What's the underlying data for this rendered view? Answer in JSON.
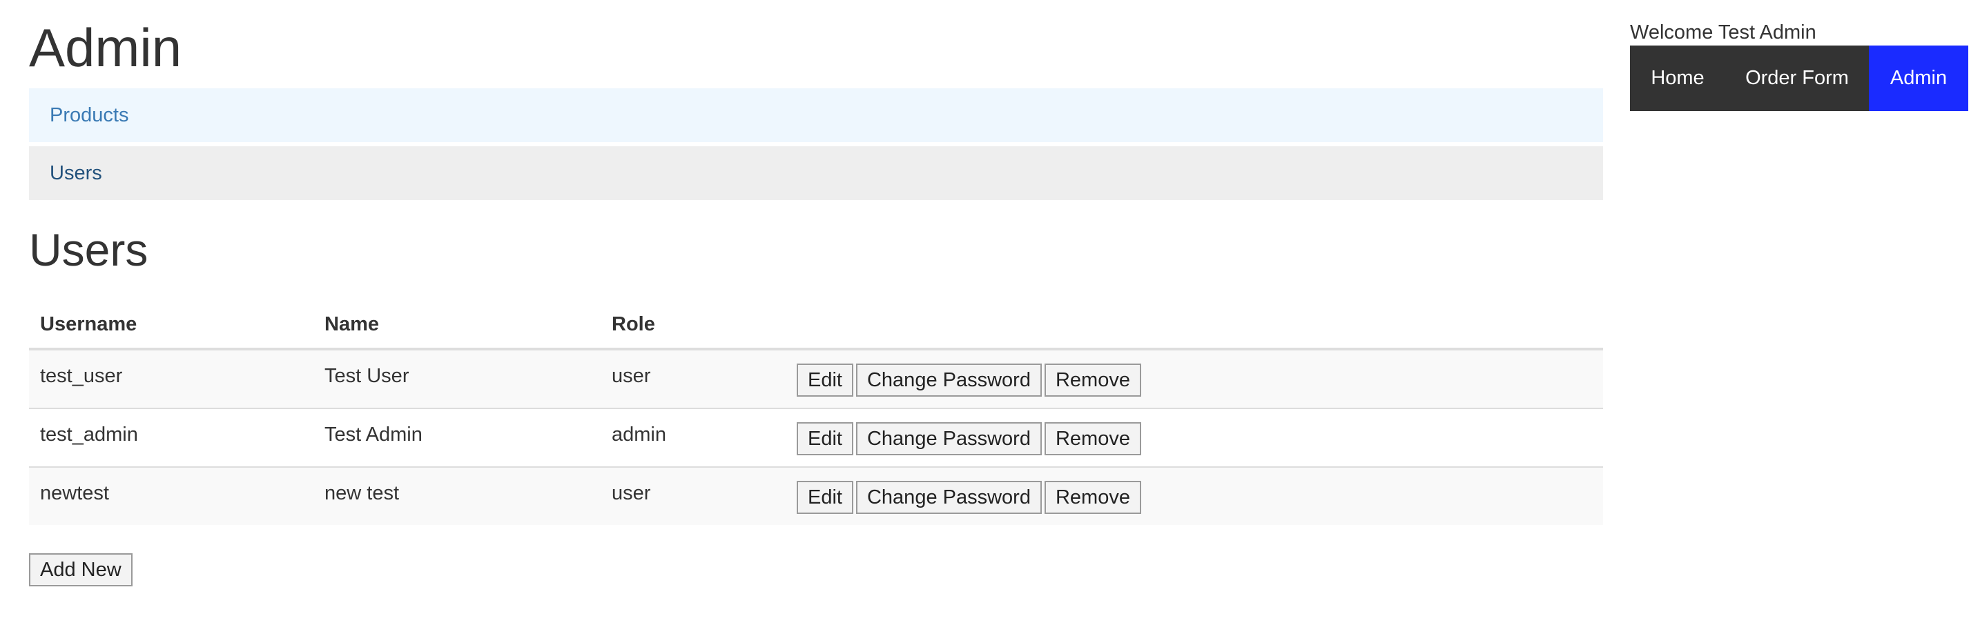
{
  "page": {
    "title": "Admin"
  },
  "subnav": {
    "items": [
      {
        "label": "Products",
        "active": false
      },
      {
        "label": "Users",
        "active": true
      }
    ]
  },
  "section": {
    "title": "Users"
  },
  "table": {
    "headers": [
      "Username",
      "Name",
      "Role",
      ""
    ],
    "rows": [
      {
        "username": "test_user",
        "name": "Test User",
        "role": "user"
      },
      {
        "username": "test_admin",
        "name": "Test Admin",
        "role": "admin"
      },
      {
        "username": "newtest",
        "name": "new test",
        "role": "user"
      }
    ],
    "row_actions": {
      "edit": "Edit",
      "change_password": "Change Password",
      "remove": "Remove"
    }
  },
  "add_new_label": "Add New",
  "header": {
    "welcome": "Welcome Test Admin",
    "nav": [
      {
        "label": "Home",
        "active": false
      },
      {
        "label": "Order Form",
        "active": false
      },
      {
        "label": "Admin",
        "active": true
      }
    ]
  },
  "colors": {
    "nav_background": "#333333",
    "nav_active": "#1a2bff",
    "link": "#337ab7",
    "subnav_active_bg": "#eeeeee",
    "subnav_hover_bg": "#eef7fe"
  }
}
